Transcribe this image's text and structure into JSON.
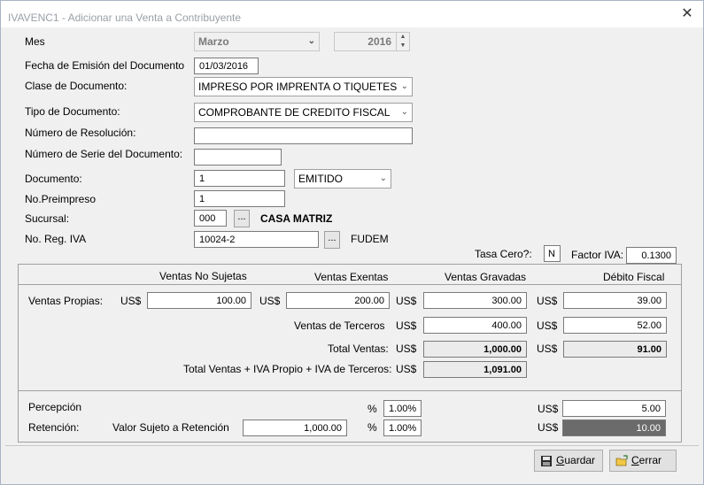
{
  "window": {
    "title": "IVAVENC1 -  Adicionar una Venta a Contribuyente",
    "close": "✕"
  },
  "form": {
    "mes_label": "Mes",
    "mes_value": "Marzo",
    "anio_value": "2016",
    "fecha_label": "Fecha de Emisión del Documento",
    "fecha_value": "01/03/2016",
    "clase_label": "Clase de Documento:",
    "clase_value": "IMPRESO POR IMPRENTA O TIQUETES",
    "tipo_label": "Tipo de Documento:",
    "tipo_value": "COMPROBANTE DE CREDITO FISCAL",
    "resolucion_label": "Número de Resolución:",
    "resolucion_value": "",
    "serie_label": "Número de Serie del Documento:",
    "serie_value": "",
    "documento_label": "Documento:",
    "documento_value": "1",
    "documento_estado": "EMITIDO",
    "preimpreso_label": "No.Preimpreso",
    "preimpreso_value": "1",
    "sucursal_label": "Sucursal:",
    "sucursal_code": "000",
    "sucursal_name": "CASA MATRIZ",
    "browse_label": "...",
    "reg_iva_label": "No. Reg. IVA",
    "reg_iva_value": "10024-2",
    "reg_iva_name": "FUDEM",
    "tasa_cero_label": "Tasa Cero?:",
    "tasa_cero_value": "N",
    "factor_iva_label": "Factor IVA:",
    "factor_iva_value": "0.1300"
  },
  "ventas": {
    "hdr_no_sujetas": "Ventas No Sujetas",
    "hdr_exentas": "Ventas Exentas",
    "hdr_gravadas": "Ventas Gravadas",
    "hdr_debito": "Débito Fiscal",
    "currency": "US$",
    "propias_label": "Ventas Propias:",
    "propias_no_sujetas": "100.00",
    "propias_exentas": "200.00",
    "propias_gravadas": "300.00",
    "propias_debito": "39.00",
    "terceros_label": "Ventas de Terceros",
    "terceros_gravadas": "400.00",
    "terceros_debito": "52.00",
    "total_label": "Total Ventas:",
    "total_gravadas": "1,000.00",
    "total_debito": "91.00",
    "total_iva_label": "Total Ventas + IVA Propio + IVA de Terceros:",
    "total_iva_value": "1,091.00"
  },
  "retenciones": {
    "percepcion_label": "Percepción",
    "pct_symbol": "%",
    "percepcion_pct": "1.00%",
    "percepcion_value": "5.00",
    "retencion_label": "Retención:",
    "valor_sujeto_label": "Valor Sujeto a Retención",
    "valor_sujeto_value": "1,000.00",
    "retencion_pct": "1.00%",
    "retencion_value": "10.00"
  },
  "buttons": {
    "guardar_accel": "G",
    "guardar_rest": "uardar",
    "cerrar_accel": "C",
    "cerrar_rest": "errar"
  }
}
